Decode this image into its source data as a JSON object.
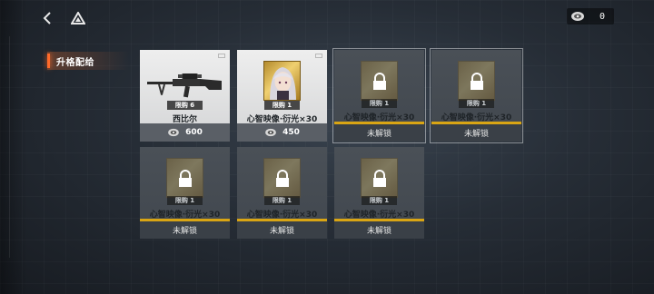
{
  "header": {
    "currency_value": "0"
  },
  "sidebar": {
    "items": [
      {
        "label": "升格配给",
        "active": true
      }
    ]
  },
  "shop": {
    "items": [
      {
        "name": "西比尔",
        "limit": "限购 6",
        "price": "600",
        "locked": false,
        "icon": "sniper-rifle-icon"
      },
      {
        "name": "心智映像·衍光×30",
        "limit": "限购 1",
        "price": "450",
        "locked": false,
        "icon": "character-portrait-icon"
      },
      {
        "name": "心智映像·衍光×30",
        "limit": "限购 1",
        "status": "未解锁",
        "locked": true
      },
      {
        "name": "心智映像·衍光×30",
        "limit": "限购 1",
        "status": "未解锁",
        "locked": true
      },
      {
        "name": "心智映像·衍光×30",
        "limit": "限购 1",
        "status": "未解锁",
        "locked": true
      },
      {
        "name": "心智映像·衍光×30",
        "limit": "限购 1",
        "status": "未解锁",
        "locked": true
      },
      {
        "name": "心智映像·衍光×30",
        "limit": "限购 1",
        "status": "未解锁",
        "locked": true
      }
    ]
  },
  "colors": {
    "accent": "#ff6a2a",
    "locked_bar": "#d9a514",
    "card_light": "#eeeeee",
    "card_dark": "#434950"
  }
}
